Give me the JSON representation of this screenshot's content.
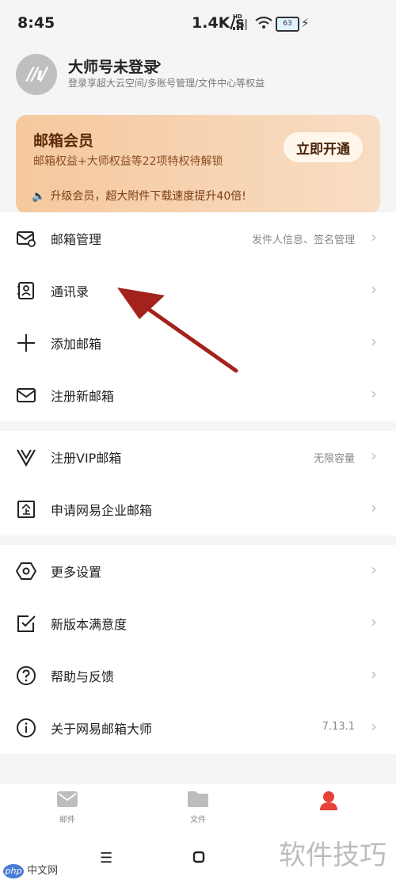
{
  "status": {
    "time": "8:45",
    "net": "1.4K/s",
    "net_tag": "HD",
    "battery": "63"
  },
  "profile": {
    "title": "大师号未登录",
    "subtitle": "登录享超大云空间/多账号管理/文件中心等权益"
  },
  "vip": {
    "title": "邮箱会员",
    "subtitle": "邮箱权益+大师权益等22项特权待解锁",
    "button": "立即开通",
    "notice": "升级会员，超大附件下载速度提升40倍!"
  },
  "menu": {
    "mail_manage": {
      "label": "邮箱管理",
      "extra": "发件人信息、签名管理"
    },
    "contacts": {
      "label": "通讯录"
    },
    "add_mailbox": {
      "label": "添加邮箱"
    },
    "register_mailbox": {
      "label": "注册新邮箱"
    },
    "register_vip": {
      "label": "注册VIP邮箱",
      "extra": "无限容量"
    },
    "enterprise": {
      "label": "申请网易企业邮箱"
    },
    "more_settings": {
      "label": "更多设置"
    },
    "satisfaction": {
      "label": "新版本满意度"
    },
    "help": {
      "label": "帮助与反馈"
    },
    "about": {
      "label": "关于网易邮箱大师",
      "extra": "7.13.1"
    }
  },
  "tabs": [
    {
      "label": "邮件"
    },
    {
      "label": "文件"
    },
    {
      "label": ""
    }
  ],
  "watermark": {
    "right": "软件技巧",
    "left_badge": "php",
    "left_text": "中文网"
  },
  "colors": {
    "accent": "#e8403a",
    "arrow": "#a3221b",
    "vip_bg": "#f6c89d"
  }
}
